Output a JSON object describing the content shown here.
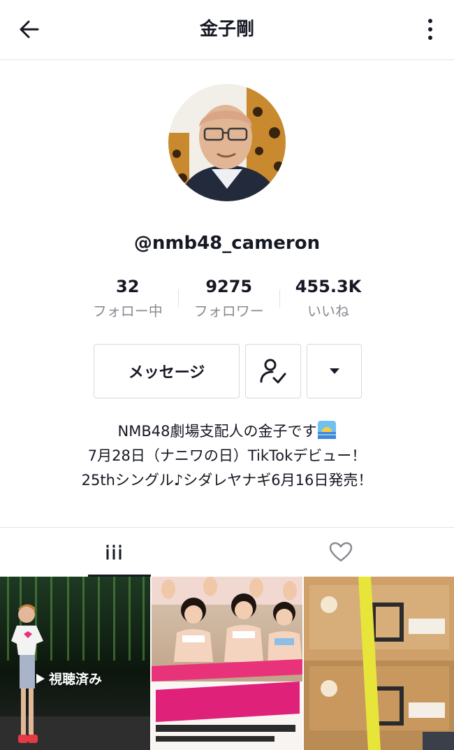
{
  "header": {
    "title": "金子剛"
  },
  "profile": {
    "username": "@nmb48_cameron"
  },
  "stats": [
    {
      "value": "32",
      "label": "フォロー中"
    },
    {
      "value": "9275",
      "label": "フォロワー"
    },
    {
      "value": "455.3K",
      "label": "いいね"
    }
  ],
  "actions": {
    "message_label": "メッセージ"
  },
  "bio": {
    "line1": "NMB48劇場支配人の金子です",
    "line2": "7月28日（ナニワの日）TikTokデビュー！",
    "line3": "25thシングル♪シダレヤナギ6月16日発売！"
  },
  "tabs": [
    {
      "icon": "grid-videos-icon",
      "active": true
    },
    {
      "icon": "heart-liked-icon",
      "active": false
    }
  ],
  "videos": [
    {
      "overlay": "視聴済み"
    },
    {
      "overlay": ""
    },
    {
      "overlay": ""
    }
  ],
  "icons": {
    "back": "arrow-left-icon",
    "more": "vertical-dots-icon",
    "follow": "user-check-icon",
    "dropdown": "caret-down-icon",
    "sunrise": "sunrise-emoji-icon"
  },
  "colors": {
    "text": "#161823",
    "secondary": "#8a8b91",
    "border": "#e3e3e4"
  }
}
